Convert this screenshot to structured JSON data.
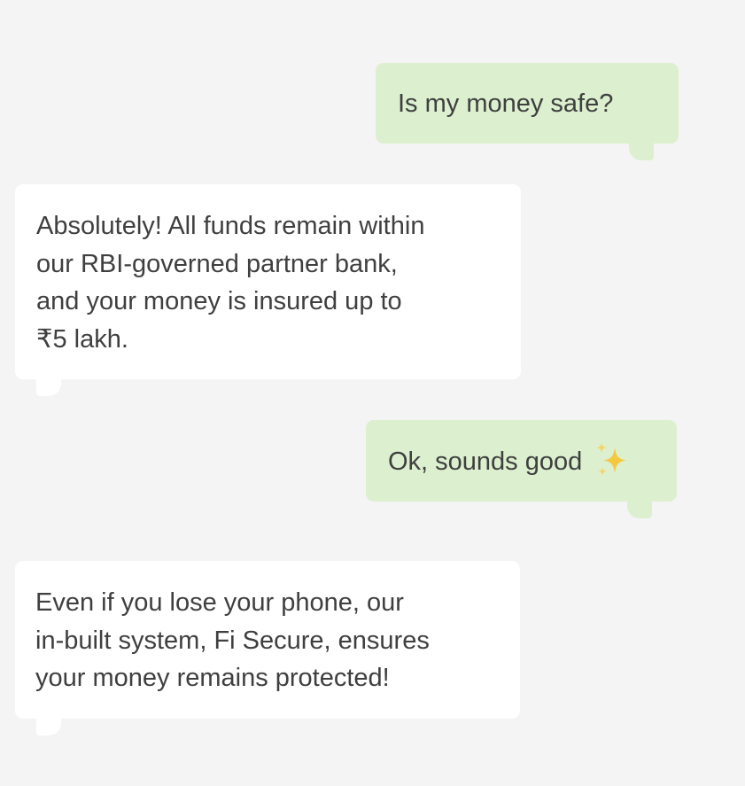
{
  "messages": [
    {
      "sender": "user",
      "text": "Is my money safe?"
    },
    {
      "sender": "bot",
      "text": "Absolutely! All funds remain within\nour RBI-governed partner bank,\nand your money is insured up to\n₹5 lakh."
    },
    {
      "sender": "user",
      "text": "Ok, sounds good",
      "icon": "sparkles-icon"
    },
    {
      "sender": "bot",
      "text": "Even if you lose your phone, our\nin-built system, Fi Secure, ensures\nyour money remains protected!"
    }
  ],
  "colors": {
    "background": "#f4f4f4",
    "outgoing_bubble": "#dcf0cf",
    "incoming_bubble": "#ffffff",
    "text": "#3f3f3f",
    "sparkle": "#f5c842"
  }
}
